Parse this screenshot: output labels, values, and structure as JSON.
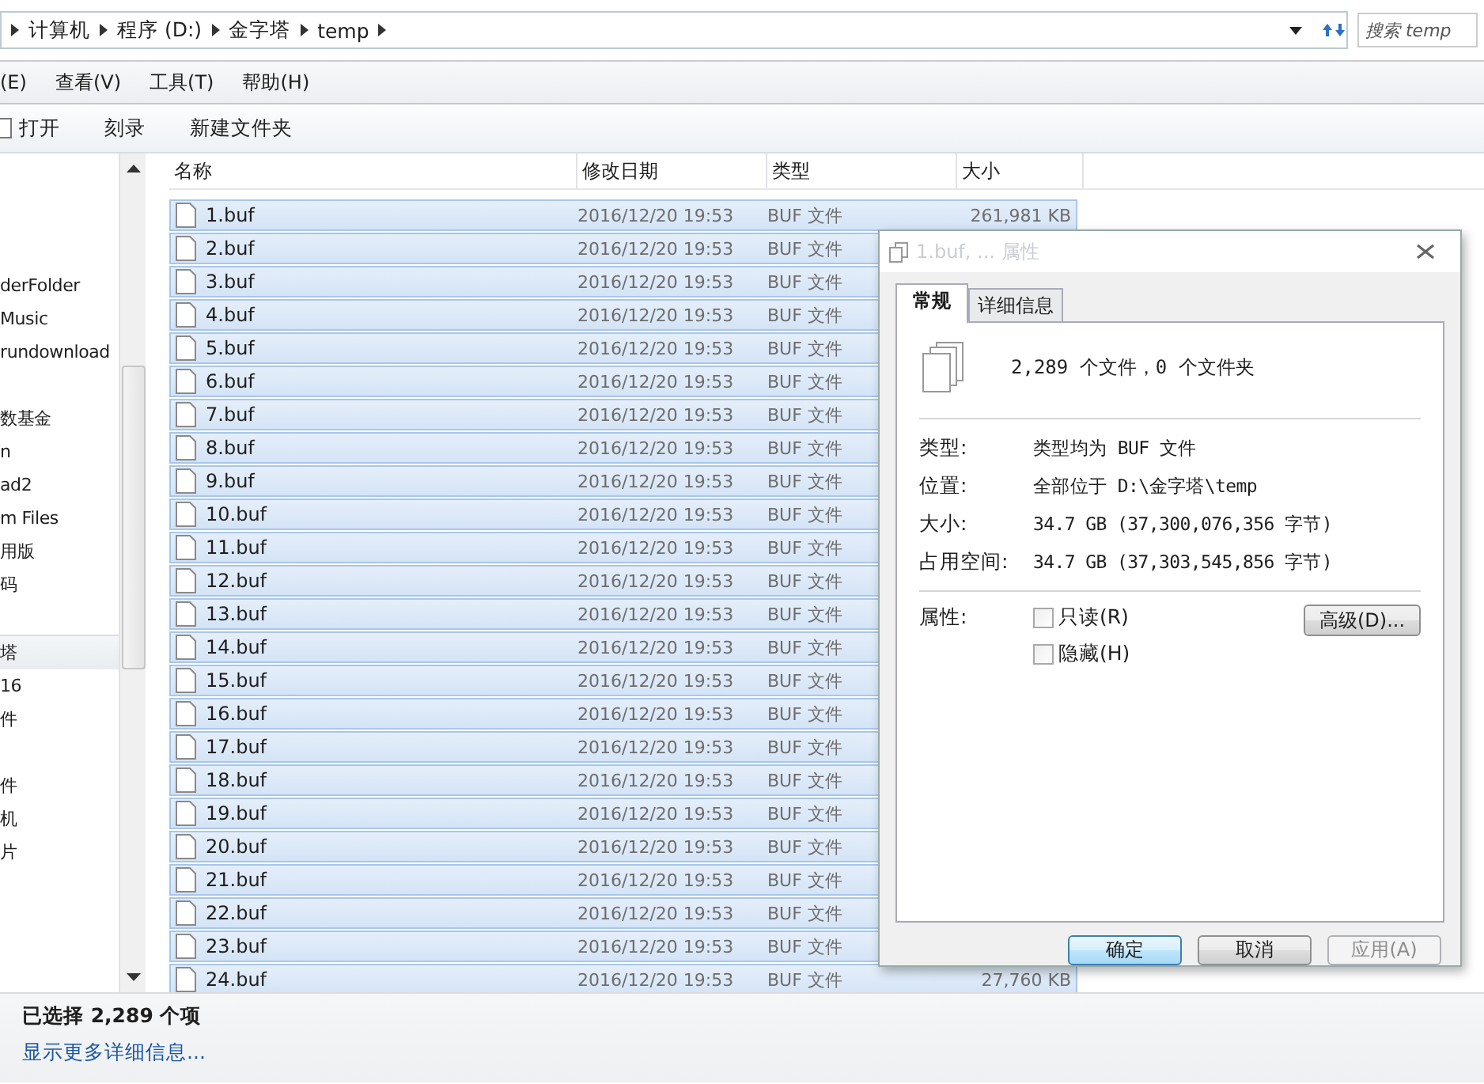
{
  "address_bar": {
    "crumbs": [
      "计算机",
      "程序 (D:)",
      "金字塔",
      "temp"
    ],
    "search": {
      "placeholder": "搜索 temp"
    }
  },
  "menu_bar": [
    "(E)",
    "查看(V)",
    "工具(T)",
    "帮助(H)"
  ],
  "toolbar": [
    "打开",
    "刻录",
    "新建文件夹"
  ],
  "sidebar": {
    "items": [
      {
        "label": "derFolder",
        "selected": false
      },
      {
        "label": "Music",
        "selected": false
      },
      {
        "label": "rundownload",
        "selected": false
      },
      {
        "selected": false
      },
      {
        "label": "数基金",
        "selected": false
      },
      {
        "label": "n",
        "selected": false
      },
      {
        "label": "ad2",
        "selected": false
      },
      {
        "label": "m Files",
        "selected": false
      },
      {
        "label": "用版",
        "selected": false
      },
      {
        "label": "码",
        "selected": false
      },
      {
        "selected": false
      },
      {
        "label": "塔",
        "selected": true
      },
      {
        "label": "16",
        "selected": false
      },
      {
        "label": "件",
        "selected": false
      },
      {
        "selected": false
      },
      {
        "label": "件",
        "selected": false
      },
      {
        "label": "机",
        "selected": false
      },
      {
        "label": "片",
        "selected": false
      }
    ]
  },
  "file_list": {
    "columns": [
      "名称",
      "修改日期",
      "类型",
      "大小"
    ],
    "rows": [
      {
        "name": "1.buf",
        "date": "2016/12/20 19:53",
        "type": "BUF 文件",
        "size": "261,981 KB",
        "selected": true
      },
      {
        "name": "2.buf",
        "date": "2016/12/20 19:53",
        "type": "BUF 文件",
        "selected": true
      },
      {
        "name": "3.buf",
        "date": "2016/12/20 19:53",
        "type": "BUF 文件",
        "selected": true
      },
      {
        "name": "4.buf",
        "date": "2016/12/20 19:53",
        "type": "BUF 文件",
        "selected": true
      },
      {
        "name": "5.buf",
        "date": "2016/12/20 19:53",
        "type": "BUF 文件",
        "selected": true
      },
      {
        "name": "6.buf",
        "date": "2016/12/20 19:53",
        "type": "BUF 文件",
        "selected": true
      },
      {
        "name": "7.buf",
        "date": "2016/12/20 19:53",
        "type": "BUF 文件",
        "selected": true
      },
      {
        "name": "8.buf",
        "date": "2016/12/20 19:53",
        "type": "BUF 文件",
        "selected": true
      },
      {
        "name": "9.buf",
        "date": "2016/12/20 19:53",
        "type": "BUF 文件",
        "selected": true
      },
      {
        "name": "10.buf",
        "date": "2016/12/20 19:53",
        "type": "BUF 文件",
        "selected": true
      },
      {
        "name": "11.buf",
        "date": "2016/12/20 19:53",
        "type": "BUF 文件",
        "selected": true
      },
      {
        "name": "12.buf",
        "date": "2016/12/20 19:53",
        "type": "BUF 文件",
        "selected": true
      },
      {
        "name": "13.buf",
        "date": "2016/12/20 19:53",
        "type": "BUF 文件",
        "selected": true
      },
      {
        "name": "14.buf",
        "date": "2016/12/20 19:53",
        "type": "BUF 文件",
        "selected": true
      },
      {
        "name": "15.buf",
        "date": "2016/12/20 19:53",
        "type": "BUF 文件",
        "selected": true
      },
      {
        "name": "16.buf",
        "date": "2016/12/20 19:53",
        "type": "BUF 文件",
        "selected": true
      },
      {
        "name": "17.buf",
        "date": "2016/12/20 19:53",
        "type": "BUF 文件",
        "selected": true
      },
      {
        "name": "18.buf",
        "date": "2016/12/20 19:53",
        "type": "BUF 文件",
        "selected": true
      },
      {
        "name": "19.buf",
        "date": "2016/12/20 19:53",
        "type": "BUF 文件",
        "selected": true
      },
      {
        "name": "20.buf",
        "date": "2016/12/20 19:53",
        "type": "BUF 文件",
        "selected": true
      },
      {
        "name": "21.buf",
        "date": "2016/12/20 19:53",
        "type": "BUF 文件",
        "selected": true
      },
      {
        "name": "22.buf",
        "date": "2016/12/20 19:53",
        "type": "BUF 文件",
        "selected": true
      },
      {
        "name": "23.buf",
        "date": "2016/12/20 19:53",
        "type": "BUF 文件",
        "selected": true
      },
      {
        "name": "24.buf",
        "date": "2016/12/20 19:53",
        "type": "BUF 文件",
        "size": "27,760 KB",
        "selected": true
      }
    ]
  },
  "status_bar": {
    "selection": "已选择 2,289 个项",
    "details_link": "显示更多详细信息..."
  },
  "dialog": {
    "title": "1.buf, ... 属性",
    "tabs": [
      {
        "label": "常规",
        "selected": true
      },
      {
        "label": "详细信息",
        "selected": false
      }
    ],
    "summary": "2,289 个文件，0 个文件夹",
    "properties": [
      {
        "label": "类型:",
        "value": "类型均为 BUF 文件"
      },
      {
        "label": "位置:",
        "value": "全部位于 D:\\金字塔\\temp"
      }
    ],
    "sizes": [
      {
        "label": "大小:",
        "value": "34.7 GB (37,300,076,356 字节)"
      },
      {
        "label": "占用空间:",
        "value": "34.7 GB (37,303,545,856 字节)"
      }
    ],
    "attributes_label": "属性:",
    "attributes": [
      {
        "label": "只读(R)",
        "checked": false
      },
      {
        "label": "隐藏(H)",
        "checked": false
      }
    ],
    "advanced_button": "高级(D)...",
    "buttons": [
      {
        "label": "确定",
        "kind": "default",
        "disabled": false
      },
      {
        "label": "取消",
        "kind": "normal",
        "disabled": false
      },
      {
        "label": "应用(A)",
        "kind": "normal",
        "disabled": true
      }
    ]
  }
}
